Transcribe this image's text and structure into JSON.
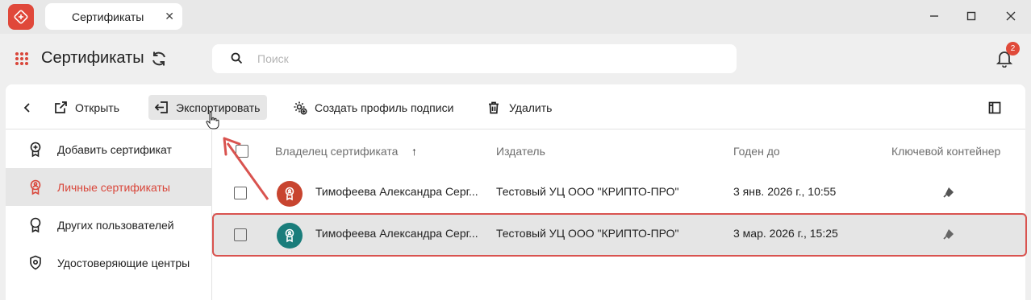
{
  "window": {
    "tab_title": "Сертификаты",
    "tab_close": "✕",
    "colors": {
      "brand": "#e0483a",
      "accent": "#d9463a",
      "highlight": "#d9534f"
    }
  },
  "header": {
    "title": "Сертификаты",
    "search_placeholder": "Поиск",
    "notifications_count": "2"
  },
  "toolbar": {
    "back_icon": "chevron-left-icon",
    "open_label": "Открыть",
    "export_label": "Экспортировать",
    "create_profile_label": "Создать профиль подписи",
    "delete_label": "Удалить",
    "panel_icon": "sidebar-panel-icon"
  },
  "sidebar": {
    "items": [
      {
        "label": "Добавить сертификат",
        "icon": "certificate-add-icon"
      },
      {
        "label": "Личные сертификаты",
        "icon": "certificate-personal-icon",
        "active": true
      },
      {
        "label": "Других пользователей",
        "icon": "certificate-others-icon"
      },
      {
        "label": "Удостоверяющие центры",
        "icon": "shield-icon"
      }
    ]
  },
  "table": {
    "columns": {
      "owner": "Владелец сертификата",
      "issuer": "Издатель",
      "valid_until": "Годен до",
      "key_container": "Ключевой контейнер"
    },
    "sort_indicator": "↑",
    "rows": [
      {
        "owner": "Тимофеева Александра Серг...",
        "issuer": "Тестовый УЦ ООО \"КРИПТО-ПРО\"",
        "valid_until": "3 янв. 2026 г., 10:55",
        "avatar_color": "#c8442f",
        "key_icon": "usb-key-icon"
      },
      {
        "owner": "Тимофеева Александра Серг...",
        "issuer": "Тестовый УЦ ООО \"КРИПТО-ПРО\"",
        "valid_until": "3 мар. 2026 г., 15:25",
        "avatar_color": "#1a7d7b",
        "key_icon": "usb-key-icon",
        "selected": true
      }
    ]
  }
}
